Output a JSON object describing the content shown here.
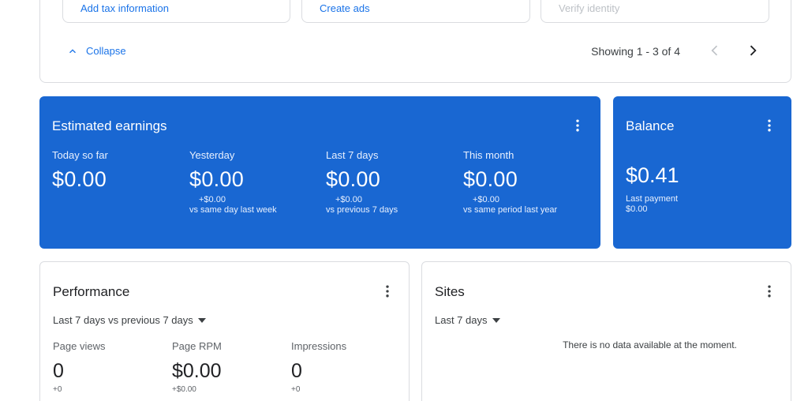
{
  "tasks": {
    "tiles": [
      {
        "label": "Add tax information"
      },
      {
        "label": "Create ads"
      },
      {
        "label": "Verify identity"
      }
    ],
    "collapse_label": "Collapse",
    "showing": "Showing 1 - 3 of 4"
  },
  "earnings": {
    "title": "Estimated earnings",
    "columns": [
      {
        "label": "Today so far",
        "value": "$0.00",
        "delta": "",
        "compare": ""
      },
      {
        "label": "Yesterday",
        "value": "$0.00",
        "delta": "+$0.00",
        "compare": "vs same day last week"
      },
      {
        "label": "Last 7 days",
        "value": "$0.00",
        "delta": "+$0.00",
        "compare": "vs previous 7 days"
      },
      {
        "label": "This month",
        "value": "$0.00",
        "delta": "+$0.00",
        "compare": "vs same period last year"
      }
    ]
  },
  "balance": {
    "title": "Balance",
    "value": "$0.41",
    "last_payment_label": "Last payment",
    "last_payment_value": "$0.00"
  },
  "performance": {
    "title": "Performance",
    "range": "Last 7 days vs previous 7 days",
    "metrics": [
      {
        "label": "Page views",
        "value": "0",
        "delta": "+0"
      },
      {
        "label": "Page RPM",
        "value": "$0.00",
        "delta": "+$0.00"
      },
      {
        "label": "Impressions",
        "value": "0",
        "delta": "+0"
      }
    ]
  },
  "sites": {
    "title": "Sites",
    "range": "Last 7 days",
    "empty_message": "There is no data available at the moment."
  },
  "colors": {
    "accent": "#1a73e8",
    "card_blue": "#1967d2"
  },
  "icons": [
    "chevron-up-icon",
    "chevron-left-icon",
    "chevron-right-icon",
    "more-vert-icon",
    "dropdown-arrow-icon"
  ]
}
